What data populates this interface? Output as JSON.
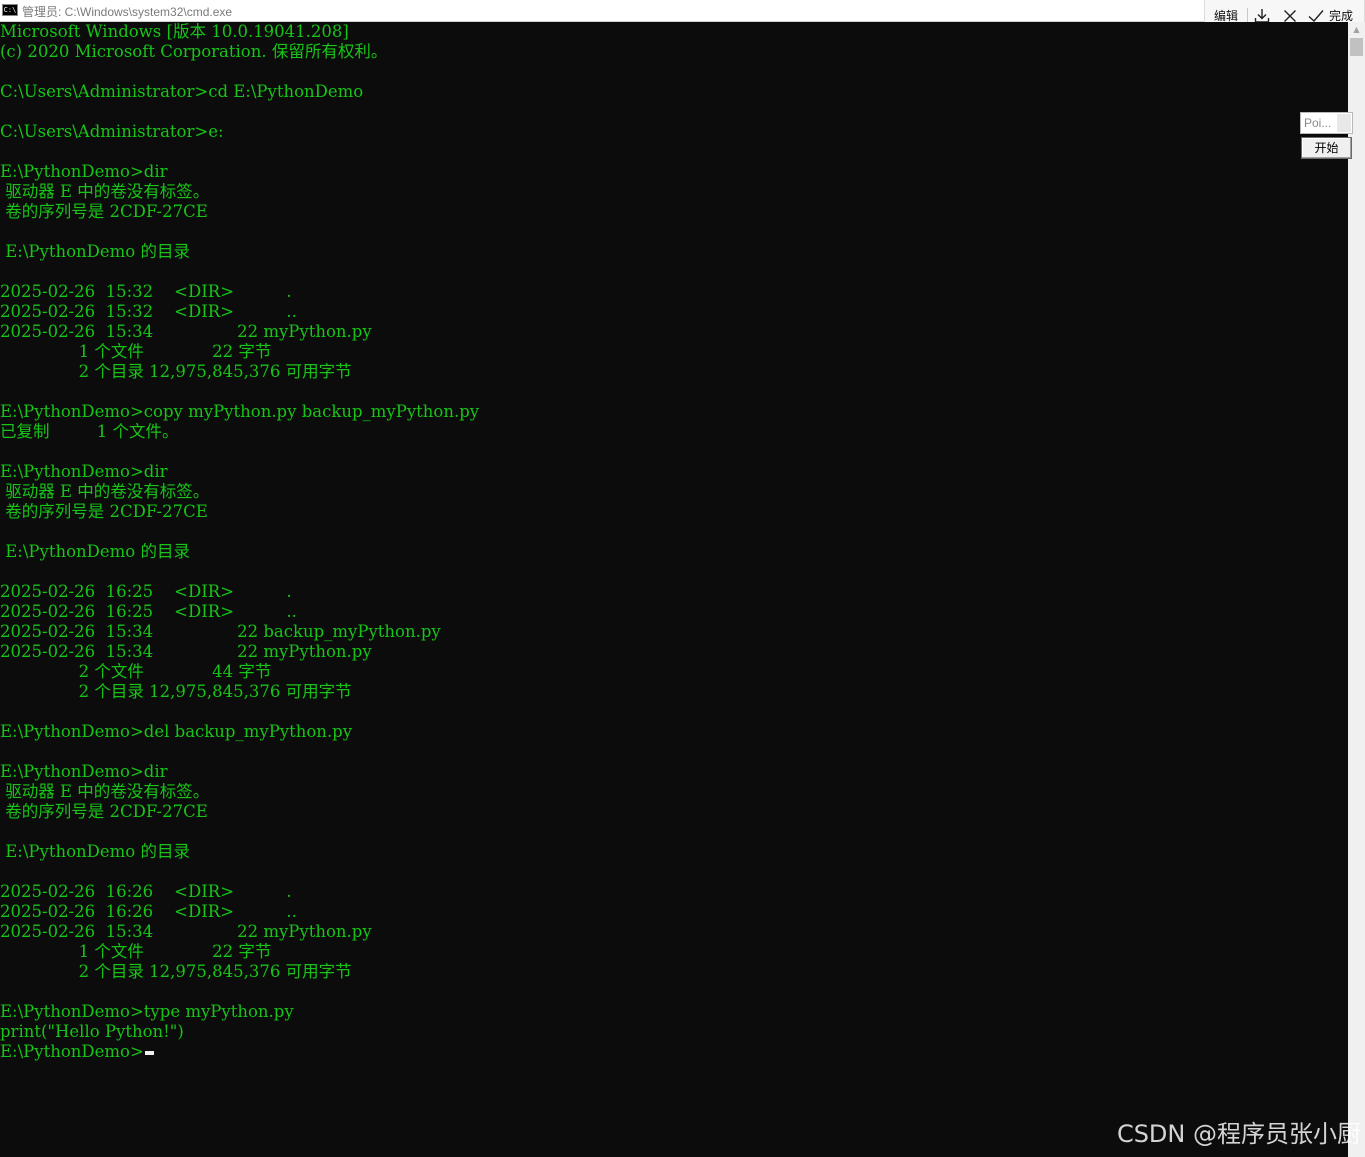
{
  "window": {
    "title": "管理员: C:\\Windows\\system32\\cmd.exe",
    "icon": "cmd-icon"
  },
  "snip_toolbar": {
    "edit_label": "编辑",
    "download_icon": "download-icon",
    "close_icon": "close-icon",
    "done_icon": "check-icon",
    "done_label": "完成"
  },
  "floating_widget": {
    "input_value": "Poi...",
    "button_label": "开始"
  },
  "console": {
    "text_color": "#17c417",
    "background": "#0c0c0c",
    "lines": [
      "Microsoft Windows [版本 10.0.19041.208]",
      "(c) 2020 Microsoft Corporation. 保留所有权利。",
      "",
      "C:\\Users\\Administrator>cd E:\\PythonDemo",
      "",
      "C:\\Users\\Administrator>e:",
      "",
      "E:\\PythonDemo>dir",
      " 驱动器 E 中的卷没有标签。",
      " 卷的序列号是 2CDF-27CE",
      "",
      " E:\\PythonDemo 的目录",
      "",
      "2025-02-26  15:32    <DIR>          .",
      "2025-02-26  15:32    <DIR>          ..",
      "2025-02-26  15:34                22 myPython.py",
      "               1 个文件             22 字节",
      "               2 个目录 12,975,845,376 可用字节",
      "",
      "E:\\PythonDemo>copy myPython.py backup_myPython.py",
      "已复制         1 个文件。",
      "",
      "E:\\PythonDemo>dir",
      " 驱动器 E 中的卷没有标签。",
      " 卷的序列号是 2CDF-27CE",
      "",
      " E:\\PythonDemo 的目录",
      "",
      "2025-02-26  16:25    <DIR>          .",
      "2025-02-26  16:25    <DIR>          ..",
      "2025-02-26  15:34                22 backup_myPython.py",
      "2025-02-26  15:34                22 myPython.py",
      "               2 个文件             44 字节",
      "               2 个目录 12,975,845,376 可用字节",
      "",
      "E:\\PythonDemo>del backup_myPython.py",
      "",
      "E:\\PythonDemo>dir",
      " 驱动器 E 中的卷没有标签。",
      " 卷的序列号是 2CDF-27CE",
      "",
      " E:\\PythonDemo 的目录",
      "",
      "2025-02-26  16:26    <DIR>          .",
      "2025-02-26  16:26    <DIR>          ..",
      "2025-02-26  15:34                22 myPython.py",
      "               1 个文件             22 字节",
      "               2 个目录 12,975,845,376 可用字节",
      "",
      "E:\\PythonDemo>type myPython.py",
      "print(\"Hello Python!\")"
    ],
    "prompt": "E:\\PythonDemo>"
  },
  "watermark": "CSDN @程序员张小厨"
}
